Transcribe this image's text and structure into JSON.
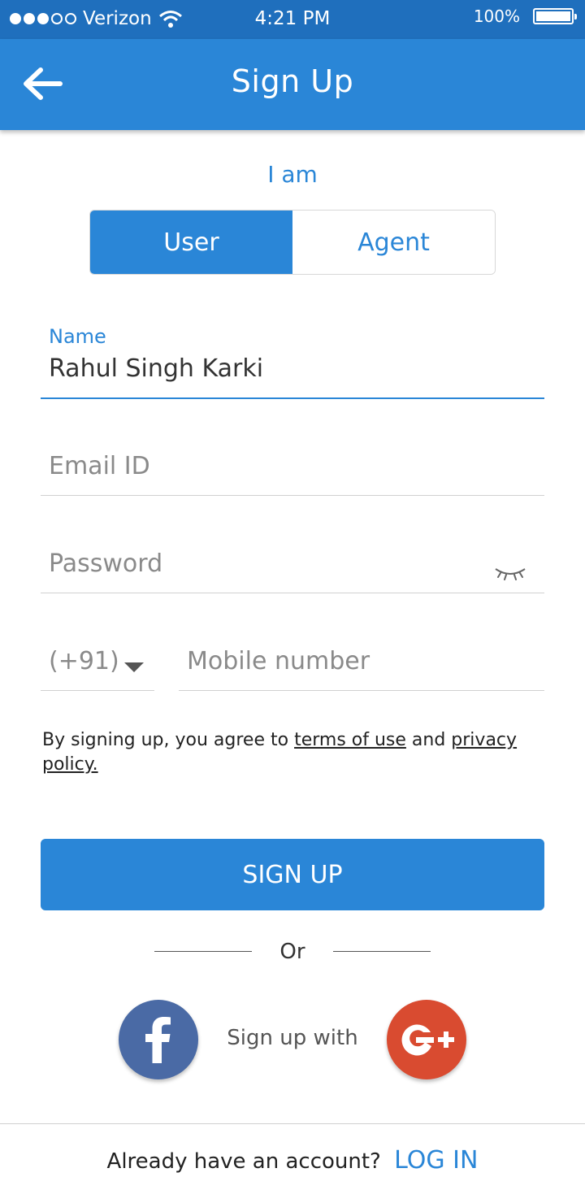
{
  "status_bar": {
    "carrier": "Verizon",
    "time": "4:21 PM",
    "battery": "100%",
    "signal_strength": 3
  },
  "app_bar": {
    "title": "Sign Up",
    "back_icon": "arrow-left-icon"
  },
  "role": {
    "label": "I am",
    "options": [
      "User",
      "Agent"
    ],
    "selected": "User"
  },
  "form": {
    "name": {
      "label": "Name",
      "value": "Rahul Singh Karki"
    },
    "email": {
      "placeholder": "Email ID",
      "value": ""
    },
    "password": {
      "placeholder": "Password",
      "value": "",
      "toggle_icon": "eye-closed-icon"
    },
    "country_code": {
      "value": "(+91)"
    },
    "mobile": {
      "placeholder": "Mobile number",
      "value": ""
    }
  },
  "terms": {
    "prefix": "By signing up, you agree to ",
    "terms_link": "terms of use",
    "and": " and ",
    "privacy_link": "privacy policy."
  },
  "signup_button": "SIGN UP",
  "divider_text": "Or",
  "social": {
    "label": "Sign up with",
    "facebook_icon": "facebook-icon",
    "google_plus_icon": "google-plus-icon"
  },
  "footer": {
    "prompt": "Already have an account?",
    "login_link": "LOG IN"
  },
  "colors": {
    "primary": "#2a86d7",
    "status_bar": "#1f6fbd",
    "facebook": "#4a6aa5",
    "google_plus": "#d94b30"
  }
}
